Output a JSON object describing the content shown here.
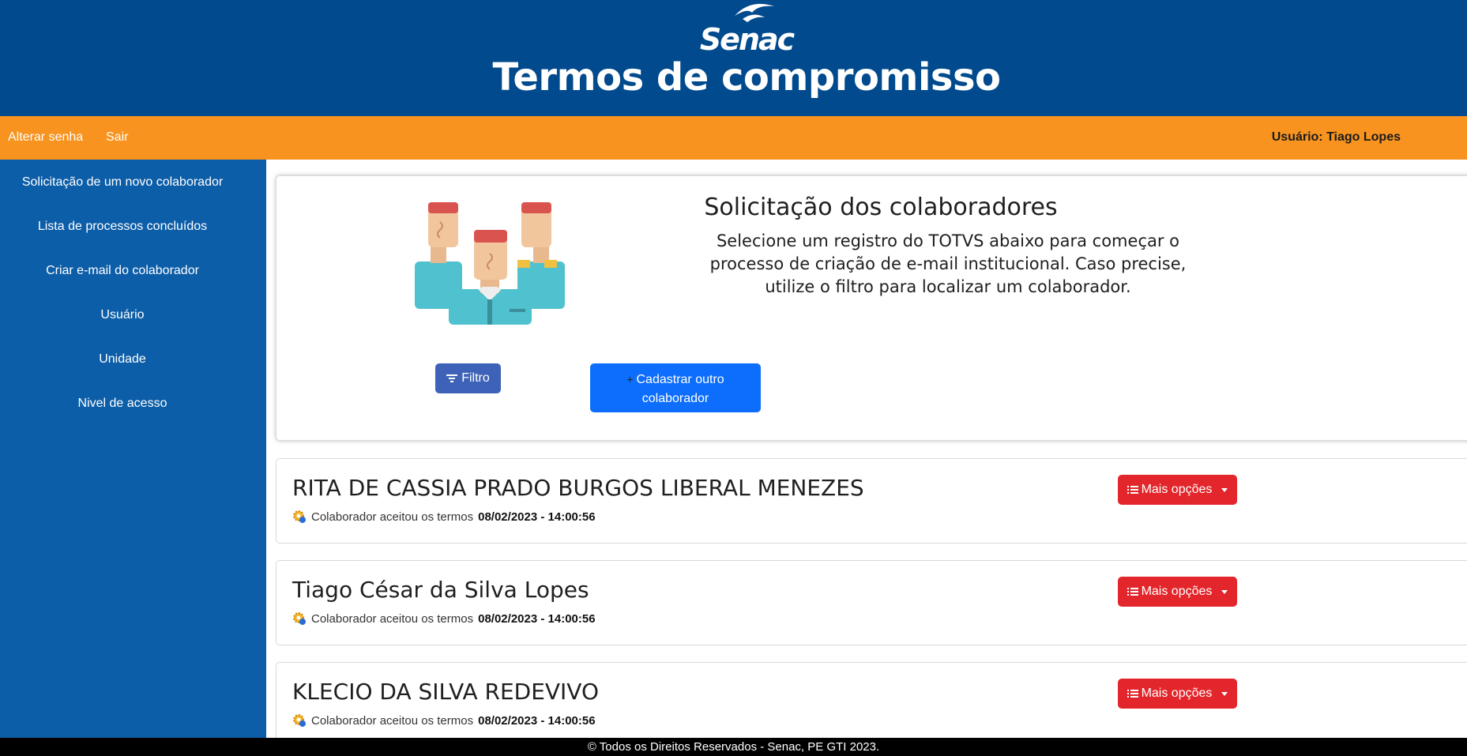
{
  "header": {
    "logo_text": "Senac",
    "title": "Termos de compromisso"
  },
  "topbar": {
    "change_password": "Alterar senha",
    "logout": "Sair",
    "user_label": "Usuário: Tiago Lopes"
  },
  "sidebar": {
    "items": [
      {
        "label": "Solicitação de um novo colaborador"
      },
      {
        "label": "Lista de processos concluídos"
      },
      {
        "label": "Criar e-mail do colaborador"
      },
      {
        "label": "Usuário"
      },
      {
        "label": "Unidade"
      },
      {
        "label": "Nivel de acesso"
      }
    ]
  },
  "intro": {
    "title": "Solicitação dos colaboradores",
    "text": "Selecione um registro do TOTVS abaixo para começar o processo de criação de e-mail institucional. Caso precise, utilize o filtro para localizar um colaborador.",
    "filter_label": "Filtro",
    "add_label": "Cadastrar outro colaborador"
  },
  "records": [
    {
      "name": "RITA DE CASSIA PRADO BURGOS LIBERAL MENEZES",
      "status": "Colaborador aceitou os termos",
      "datetime": "08/02/2023 - 14:00:56",
      "action": "Mais opções"
    },
    {
      "name": "Tiago César da Silva Lopes",
      "status": "Colaborador aceitou os termos",
      "datetime": "08/02/2023 - 14:00:56",
      "action": "Mais opções"
    },
    {
      "name": "KLECIO DA SILVA REDEVIVO",
      "status": "Colaborador aceitou os termos",
      "datetime": "08/02/2023 - 14:00:56",
      "action": "Mais opções"
    }
  ],
  "footer": {
    "text": "© Todos os Direitos Reservados - Senac, PE GTI 2023."
  },
  "colors": {
    "header_blue": "#004a8d",
    "topbar_orange": "#f7931e",
    "sidebar_blue": "#0d5ea8",
    "action_red": "#e3262b",
    "primary_blue": "#0d6efd"
  }
}
